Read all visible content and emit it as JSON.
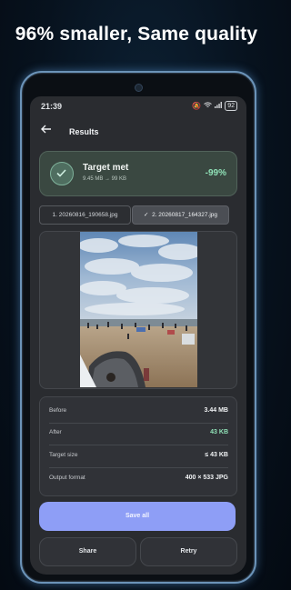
{
  "headline": "96% smaller, Same quality",
  "status": {
    "time": "21:39",
    "battery": "92"
  },
  "appbar": {
    "title": "Results"
  },
  "target": {
    "title": "Target met",
    "sizes": "9.45 MB → 99 KB",
    "reduction": "-99%"
  },
  "files": [
    {
      "label": "1. 20260816_190658.jpg",
      "selected": false
    },
    {
      "label": "2. 20260817_164327.jpg",
      "selected": true,
      "check": "✓"
    }
  ],
  "details": {
    "before": {
      "label": "Before",
      "value": "3.44 MB"
    },
    "after": {
      "label": "After",
      "value": "43 KB"
    },
    "target_size": {
      "label": "Target size",
      "value": "≤ 43 KB"
    },
    "output_format": {
      "label": "Output format",
      "value": "400 × 533 JPG"
    }
  },
  "actions": {
    "save_all": "Save all",
    "share": "Share",
    "retry": "Retry"
  },
  "colors": {
    "accent": "#8e9ef6",
    "success": "#8fe0b6",
    "background": "#2a2c30"
  }
}
